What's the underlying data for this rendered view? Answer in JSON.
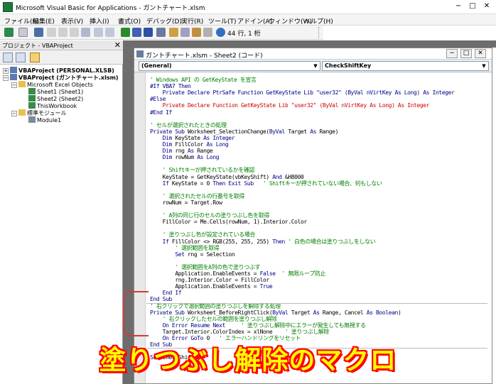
{
  "window": {
    "title": "Microsoft Visual Basic for Applications - ガントチャート.xlsm",
    "minimize": "−",
    "maximize": "□",
    "close": "✕"
  },
  "menu": [
    "ファイル(F)",
    "編集(E)",
    "表示(V)",
    "挿入(I)",
    "書式(O)",
    "デバッグ(D)",
    "実行(R)",
    "ツール(T)",
    "アドイン(A)",
    "ウィンドウ(W)",
    "ヘルプ(H)"
  ],
  "toolbar": {
    "position": "44 行, 1 桁"
  },
  "project_panel": {
    "title": "プロジェクト - VBAProject",
    "close": "✕",
    "tree": [
      {
        "label": "VBAProject (PERSONAL.XLSB)",
        "level": 0,
        "expander": "+"
      },
      {
        "label": "VBAProject (ガントチャート.xlsm)",
        "level": 0,
        "expander": "−"
      },
      {
        "label": "Microsoft Excel Objects",
        "level": 1,
        "expander": "−"
      },
      {
        "label": "Sheet1 (Sheet1)",
        "level": 2,
        "expander": ""
      },
      {
        "label": "Sheet2 (Sheet2)",
        "level": 2,
        "expander": ""
      },
      {
        "label": "ThisWorkbook",
        "level": 2,
        "expander": ""
      },
      {
        "label": "標準モジュール",
        "level": 1,
        "expander": "−"
      },
      {
        "label": "Module1",
        "level": 2,
        "expander": ""
      }
    ]
  },
  "code_window": {
    "title": "ガントチャート.xlsm - Sheet2 (コード)",
    "min": "−",
    "max": "□",
    "close": "✕",
    "object_combo": "(General)",
    "proc_combo": "CheckShiftKey",
    "code_lines": [
      [
        {
          "t": "' Windows API の GetKeyState を宣言",
          "c": "com"
        }
      ],
      [
        {
          "t": "#If VBA7 Then",
          "c": "kw"
        }
      ],
      [
        {
          "t": "    Private Declare PtrSafe Function GetKeyState Lib \"user32\" (ByVal nVirtKey As Long) As Integer",
          "c": "kw"
        }
      ],
      [
        {
          "t": "#Else",
          "c": "kw"
        }
      ],
      [
        {
          "t": "    Private Declare Function GetKeyState Lib \"user32\" (ByVal nVirtKey As Long) As Integer",
          "c": "red"
        }
      ],
      [
        {
          "t": "#End If",
          "c": "kw"
        }
      ],
      [
        {
          "t": "",
          "c": "txt"
        }
      ],
      [
        {
          "t": "' セルが選択されたときの処理",
          "c": "com"
        }
      ],
      [
        {
          "t": "Private Sub ",
          "c": "kw"
        },
        {
          "t": "Worksheet_SelectionChange(",
          "c": "txt"
        },
        {
          "t": "ByVal ",
          "c": "kw"
        },
        {
          "t": "Target ",
          "c": "txt"
        },
        {
          "t": "As ",
          "c": "kw"
        },
        {
          "t": "Range)",
          "c": "txt"
        }
      ],
      [
        {
          "t": "    Dim ",
          "c": "kw"
        },
        {
          "t": "KeyState ",
          "c": "txt"
        },
        {
          "t": "As Integer",
          "c": "kw"
        }
      ],
      [
        {
          "t": "    Dim ",
          "c": "kw"
        },
        {
          "t": "FillColor ",
          "c": "txt"
        },
        {
          "t": "As Long",
          "c": "kw"
        }
      ],
      [
        {
          "t": "    Dim ",
          "c": "kw"
        },
        {
          "t": "rng ",
          "c": "txt"
        },
        {
          "t": "As ",
          "c": "kw"
        },
        {
          "t": "Range",
          "c": "txt"
        }
      ],
      [
        {
          "t": "    Dim ",
          "c": "kw"
        },
        {
          "t": "rowNum ",
          "c": "txt"
        },
        {
          "t": "As Long",
          "c": "kw"
        }
      ],
      [
        {
          "t": "",
          "c": "txt"
        }
      ],
      [
        {
          "t": "    ' Shiftキーが押されているかを確認",
          "c": "com"
        }
      ],
      [
        {
          "t": "    KeyState = GetKeyState(vbKeyShift) ",
          "c": "txt"
        },
        {
          "t": "And ",
          "c": "kw"
        },
        {
          "t": "&H8000",
          "c": "txt"
        }
      ],
      [
        {
          "t": "    If ",
          "c": "kw"
        },
        {
          "t": "KeyState = 0 ",
          "c": "txt"
        },
        {
          "t": "Then Exit Sub ",
          "c": "kw"
        },
        {
          "t": "  ' Shiftキーが押されていない場合、何もしない",
          "c": "com"
        }
      ],
      [
        {
          "t": "",
          "c": "txt"
        }
      ],
      [
        {
          "t": "    ' 選択されたセルの行番号を取得",
          "c": "com"
        }
      ],
      [
        {
          "t": "    rowNum = Target.Row",
          "c": "txt"
        }
      ],
      [
        {
          "t": "",
          "c": "txt"
        }
      ],
      [
        {
          "t": "    ' A列の同じ行のセルの塗りつぶし色を取得",
          "c": "com"
        }
      ],
      [
        {
          "t": "    FillColor = Me.Cells(rowNum, 1).Interior.Color",
          "c": "txt"
        }
      ],
      [
        {
          "t": "",
          "c": "txt"
        }
      ],
      [
        {
          "t": "    ' 塗りつぶし色が設定されている場合",
          "c": "com"
        }
      ],
      [
        {
          "t": "    If ",
          "c": "kw"
        },
        {
          "t": "FillColor <> RGB(255, 255, 255) ",
          "c": "txt"
        },
        {
          "t": "Then ",
          "c": "kw"
        },
        {
          "t": "' 白色の場合は塗りつぶしをしない",
          "c": "com"
        }
      ],
      [
        {
          "t": "        ' 選択範囲を取得",
          "c": "com"
        }
      ],
      [
        {
          "t": "        Set ",
          "c": "kw"
        },
        {
          "t": "rng = Selection",
          "c": "txt"
        }
      ],
      [
        {
          "t": "",
          "c": "txt"
        }
      ],
      [
        {
          "t": "        ' 選択範囲をA列の色で塗りつぶす",
          "c": "com"
        }
      ],
      [
        {
          "t": "        Application.EnableEvents = ",
          "c": "txt"
        },
        {
          "t": "False ",
          "c": "kw"
        },
        {
          "t": " ' 無限ループ防止",
          "c": "com"
        }
      ],
      [
        {
          "t": "        rng.Interior.Color = FillColor",
          "c": "txt"
        }
      ],
      [
        {
          "t": "        Application.EnableEvents = ",
          "c": "txt"
        },
        {
          "t": "True",
          "c": "kw"
        }
      ],
      [
        {
          "t": "    End If",
          "c": "kw"
        }
      ],
      [
        {
          "t": "End Sub",
          "c": "kw"
        }
      ],
      [
        {
          "t": "' 右クリックで選択範囲の塗りつぶしを解除する処理",
          "c": "com"
        }
      ],
      [
        {
          "t": "Private Sub ",
          "c": "kw"
        },
        {
          "t": "Worksheet_BeforeRightClick(",
          "c": "txt"
        },
        {
          "t": "ByVal ",
          "c": "kw"
        },
        {
          "t": "Target ",
          "c": "txt"
        },
        {
          "t": "As ",
          "c": "kw"
        },
        {
          "t": "Range, Cancel ",
          "c": "txt"
        },
        {
          "t": "As Boolean",
          "c": "kw"
        },
        {
          "t": ")",
          "c": "txt"
        }
      ],
      [
        {
          "t": "    ' 右クリックしたセルの範囲を塗りつぶし解除",
          "c": "com"
        }
      ],
      [
        {
          "t": "    On Error Resume Next ",
          "c": "kw"
        },
        {
          "t": "    ' 塗りつぶし解除中にエラーが発生しても無視する",
          "c": "com"
        }
      ],
      [
        {
          "t": "    Target.Interior.ColorIndex = xlNone ",
          "c": "txt"
        },
        {
          "t": "   ' 塗りつぶし解除",
          "c": "com"
        }
      ],
      [
        {
          "t": "    On Error GoTo ",
          "c": "kw"
        },
        {
          "t": "0 ",
          "c": "txt"
        },
        {
          "t": "  ' エラーハンドリングをリセット",
          "c": "com"
        }
      ],
      [
        {
          "t": "End Sub",
          "c": "kw"
        }
      ],
      [
        {
          "t": "",
          "c": "txt"
        }
      ],
      [
        {
          "t": "Sub ",
          "c": "kw"
        },
        {
          "t": "CheckShiftKey",
          "c": "txt"
        }
      ]
    ]
  },
  "caption": "塗りつぶし解除のマクロ",
  "colors": {
    "comment": "#008000",
    "keyword": "#00008b",
    "error": "#cc0000",
    "caption_fill": "#ffff00",
    "caption_outline": "#ff0000",
    "bracket": "#d23a3a"
  }
}
